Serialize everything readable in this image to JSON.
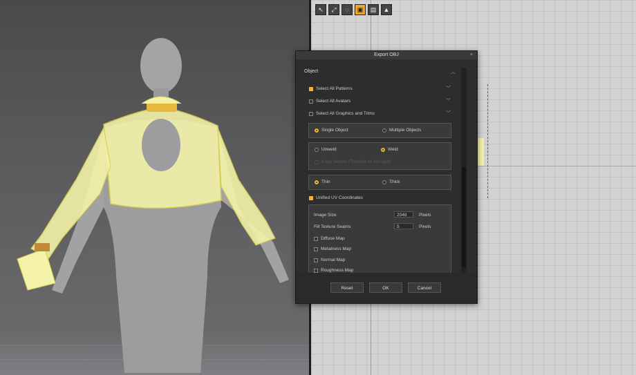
{
  "toolbar2d": {
    "tools": [
      {
        "icon": "arrow-tool-icon"
      },
      {
        "icon": "transform-tool-icon"
      },
      {
        "icon": "lasso-tool-icon"
      },
      {
        "icon": "pattern-tool-icon",
        "active": true
      },
      {
        "icon": "sewing-tool-icon"
      },
      {
        "icon": "avatar-tool-icon"
      }
    ]
  },
  "dialog": {
    "title": "Export OBJ",
    "close": "×",
    "section": "Object",
    "select_all_patterns": "Select All Patterns",
    "select_all_avatars": "Select All Avatars",
    "select_all_graphics": "Select All Graphics and Trims",
    "single_object": "Single Object",
    "multiple_objects": "Multiple Objects",
    "unweld": "Unweld",
    "weld": "Weld",
    "keep_seams": "Keep Seams (Transfer of Ver.Split)",
    "thin": "Thin",
    "thick": "Thick",
    "unified_uv": "Unified UV Coordinates",
    "image_size_label": "Image Size",
    "image_size_value": "2048",
    "image_size_unit": "Pixels",
    "fill_seams_label": "Fill Texture Seams",
    "fill_seams_value": "5",
    "fill_seams_unit": "Pixels",
    "maps": [
      "Diffuse Map",
      "Metalness Map",
      "Normal Map",
      "Roughness Map"
    ],
    "reset": "Reset",
    "ok": "OK",
    "cancel": "Cancel"
  },
  "colors": {
    "accent": "#f0b43c",
    "garment": "#f4f2a8"
  }
}
